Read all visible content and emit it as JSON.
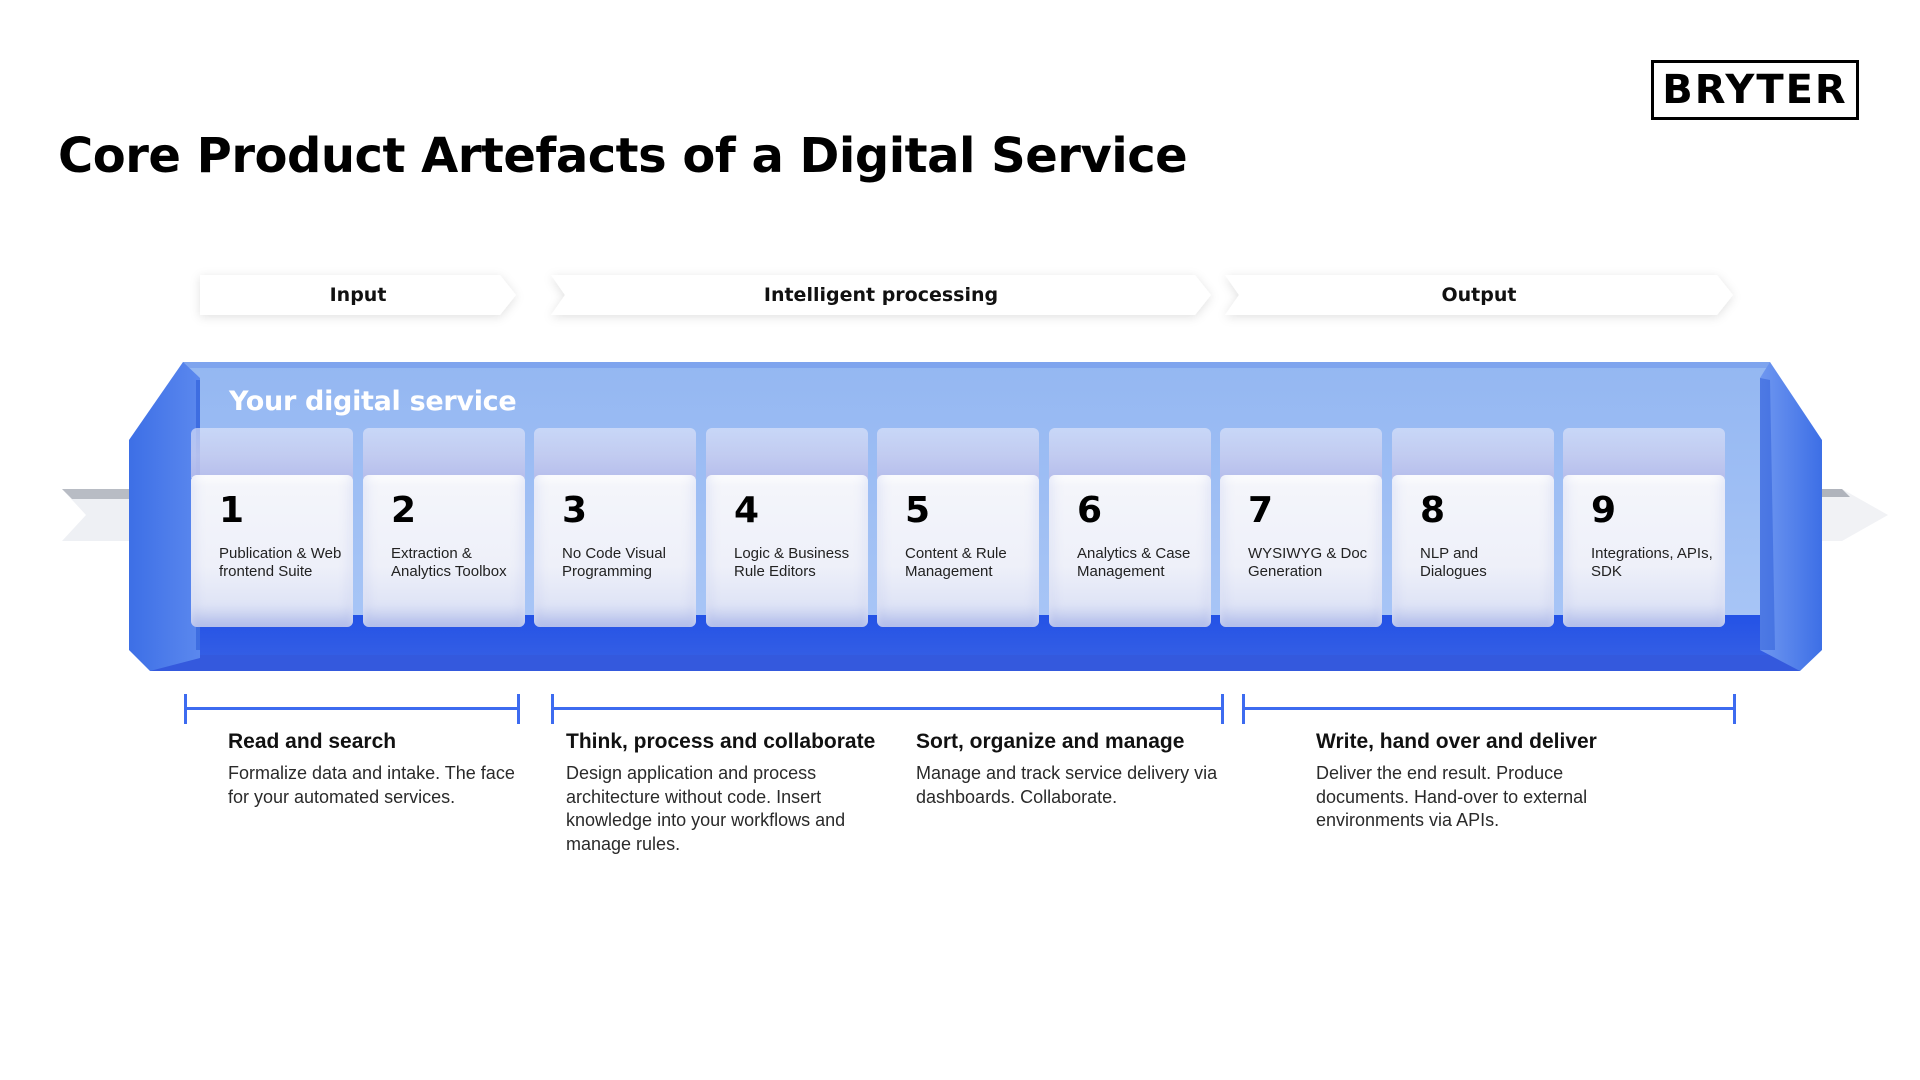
{
  "header": {
    "title": "Core Product Artefacts of a Digital Service",
    "logo_text": "BRYTER"
  },
  "phases": [
    {
      "label": "Input"
    },
    {
      "label": "Intelligent processing"
    },
    {
      "label": "Output"
    }
  ],
  "container": {
    "title": "Your digital service"
  },
  "artefacts": [
    {
      "number": "1",
      "label": "Publication & Web frontend Suite"
    },
    {
      "number": "2",
      "label": "Extraction & Analytics Toolbox"
    },
    {
      "number": "3",
      "label": "No Code Visual Programming"
    },
    {
      "number": "4",
      "label": "Logic & Business Rule Editors"
    },
    {
      "number": "5",
      "label": "Content & Rule Management"
    },
    {
      "number": "6",
      "label": "Analytics & Case Management"
    },
    {
      "number": "7",
      "label": "WYSIWYG & Doc Generation"
    },
    {
      "number": "8",
      "label": "NLP and Dialogues"
    },
    {
      "number": "9",
      "label": "Integrations, APIs, SDK"
    }
  ],
  "sections": [
    {
      "heading": "Read and search",
      "body": "Formalize data and intake. The face for your automated services."
    },
    {
      "heading": "Think, process and collaborate",
      "body": "Design application and process architecture without code. Insert knowledge into your workflows and manage rules."
    },
    {
      "heading": "Sort, organize and manage",
      "body": "Manage and track service delivery via dashboards. Collaborate."
    },
    {
      "heading": "Write, hand over and deliver",
      "body": "Deliver the end result. Produce documents. Hand-over to external environments via APIs."
    }
  ],
  "colors": {
    "accent_blue": "#3d6bf0",
    "container_light": "#9bbcf3",
    "container_dark": "#2f58e0"
  }
}
